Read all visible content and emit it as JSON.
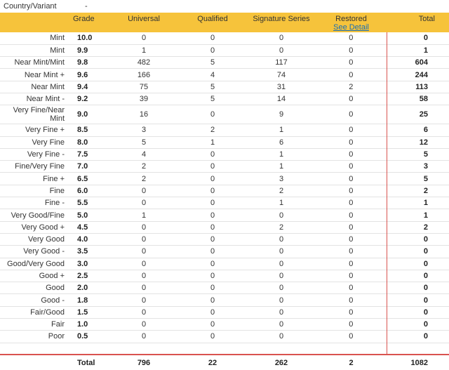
{
  "meta": {
    "label": "Country/Variant",
    "value": "-"
  },
  "headers": {
    "grade": "Grade",
    "universal": "Universal",
    "qualified": "Qualified",
    "signature": "Signature Series",
    "restored": "Restored",
    "see_detail": "See Detail",
    "total": "Total"
  },
  "rows": [
    {
      "name": "Mint",
      "grade": "10.0",
      "universal": "0",
      "qualified": "0",
      "signature": "0",
      "restored": "0",
      "total": "0"
    },
    {
      "name": "Mint",
      "grade": "9.9",
      "universal": "1",
      "qualified": "0",
      "signature": "0",
      "restored": "0",
      "total": "1"
    },
    {
      "name": "Near Mint/Mint",
      "grade": "9.8",
      "universal": "482",
      "qualified": "5",
      "signature": "117",
      "restored": "0",
      "total": "604"
    },
    {
      "name": "Near Mint +",
      "grade": "9.6",
      "universal": "166",
      "qualified": "4",
      "signature": "74",
      "restored": "0",
      "total": "244"
    },
    {
      "name": "Near Mint",
      "grade": "9.4",
      "universal": "75",
      "qualified": "5",
      "signature": "31",
      "restored": "2",
      "total": "113"
    },
    {
      "name": "Near Mint -",
      "grade": "9.2",
      "universal": "39",
      "qualified": "5",
      "signature": "14",
      "restored": "0",
      "total": "58"
    },
    {
      "name": "Very Fine/Near Mint",
      "grade": "9.0",
      "universal": "16",
      "qualified": "0",
      "signature": "9",
      "restored": "0",
      "total": "25"
    },
    {
      "name": "Very Fine +",
      "grade": "8.5",
      "universal": "3",
      "qualified": "2",
      "signature": "1",
      "restored": "0",
      "total": "6"
    },
    {
      "name": "Very Fine",
      "grade": "8.0",
      "universal": "5",
      "qualified": "1",
      "signature": "6",
      "restored": "0",
      "total": "12"
    },
    {
      "name": "Very Fine -",
      "grade": "7.5",
      "universal": "4",
      "qualified": "0",
      "signature": "1",
      "restored": "0",
      "total": "5"
    },
    {
      "name": "Fine/Very Fine",
      "grade": "7.0",
      "universal": "2",
      "qualified": "0",
      "signature": "1",
      "restored": "0",
      "total": "3"
    },
    {
      "name": "Fine +",
      "grade": "6.5",
      "universal": "2",
      "qualified": "0",
      "signature": "3",
      "restored": "0",
      "total": "5"
    },
    {
      "name": "Fine",
      "grade": "6.0",
      "universal": "0",
      "qualified": "0",
      "signature": "2",
      "restored": "0",
      "total": "2"
    },
    {
      "name": "Fine -",
      "grade": "5.5",
      "universal": "0",
      "qualified": "0",
      "signature": "1",
      "restored": "0",
      "total": "1"
    },
    {
      "name": "Very Good/Fine",
      "grade": "5.0",
      "universal": "1",
      "qualified": "0",
      "signature": "0",
      "restored": "0",
      "total": "1"
    },
    {
      "name": "Very Good +",
      "grade": "4.5",
      "universal": "0",
      "qualified": "0",
      "signature": "2",
      "restored": "0",
      "total": "2"
    },
    {
      "name": "Very Good",
      "grade": "4.0",
      "universal": "0",
      "qualified": "0",
      "signature": "0",
      "restored": "0",
      "total": "0"
    },
    {
      "name": "Very Good -",
      "grade": "3.5",
      "universal": "0",
      "qualified": "0",
      "signature": "0",
      "restored": "0",
      "total": "0"
    },
    {
      "name": "Good/Very Good",
      "grade": "3.0",
      "universal": "0",
      "qualified": "0",
      "signature": "0",
      "restored": "0",
      "total": "0"
    },
    {
      "name": "Good +",
      "grade": "2.5",
      "universal": "0",
      "qualified": "0",
      "signature": "0",
      "restored": "0",
      "total": "0"
    },
    {
      "name": "Good",
      "grade": "2.0",
      "universal": "0",
      "qualified": "0",
      "signature": "0",
      "restored": "0",
      "total": "0"
    },
    {
      "name": "Good -",
      "grade": "1.8",
      "universal": "0",
      "qualified": "0",
      "signature": "0",
      "restored": "0",
      "total": "0"
    },
    {
      "name": "Fair/Good",
      "grade": "1.5",
      "universal": "0",
      "qualified": "0",
      "signature": "0",
      "restored": "0",
      "total": "0"
    },
    {
      "name": "Fair",
      "grade": "1.0",
      "universal": "0",
      "qualified": "0",
      "signature": "0",
      "restored": "0",
      "total": "0"
    },
    {
      "name": "Poor",
      "grade": "0.5",
      "universal": "0",
      "qualified": "0",
      "signature": "0",
      "restored": "0",
      "total": "0"
    }
  ],
  "totals": {
    "label": "Total",
    "universal": "796",
    "qualified": "22",
    "signature": "262",
    "restored": "2",
    "total": "1082"
  },
  "colors": {
    "header_bg": "#f6c33b",
    "accent_line": "#d9534f",
    "link": "#1a6fb5"
  }
}
